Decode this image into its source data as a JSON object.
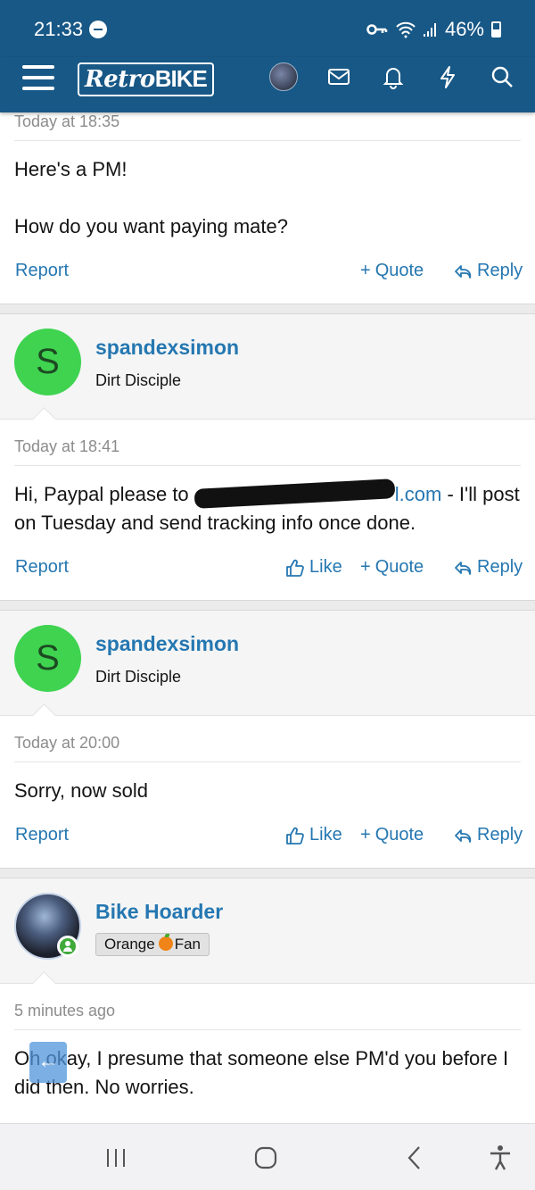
{
  "status": {
    "time": "21:33",
    "battery": "46%"
  },
  "nav": {
    "logo_prefix": "Retro",
    "logo_suffix": "BIKE"
  },
  "posts": [
    {
      "date": "Today at 18:35",
      "body": [
        "Here's a PM!",
        "How do you want paying mate?"
      ],
      "actions": {
        "report": "Report",
        "quote": "Quote",
        "reply": "Reply"
      }
    },
    {
      "user": {
        "initial": "S",
        "name": "spandexsimon",
        "title": "Dirt Disciple"
      },
      "date": "Today at 18:41",
      "body_pre": "Hi, Paypal please to ",
      "body_link": "l.com",
      "body_post": " - I'll post on Tuesday and send tracking info once done.",
      "actions": {
        "report": "Report",
        "like": "Like",
        "quote": "Quote",
        "reply": "Reply"
      }
    },
    {
      "user": {
        "initial": "S",
        "name": "spandexsimon",
        "title": "Dirt Disciple"
      },
      "date": "Today at 20:00",
      "body": "Sorry, now sold",
      "actions": {
        "report": "Report",
        "like": "Like",
        "quote": "Quote",
        "reply": "Reply"
      }
    },
    {
      "user": {
        "name": "Bike Hoarder",
        "banner_pre": "Orange",
        "banner_post": "Fan"
      },
      "date": "5 minutes ago",
      "body": "Oh okay, I presume that someone else PM'd you before I did then. No worries."
    }
  ],
  "icons": {
    "menu": "hamburger-icon",
    "messages": "envelope-icon",
    "alerts": "bell-icon",
    "whats_new": "bolt-icon",
    "search": "search-icon",
    "back": "arrow-left-icon"
  },
  "colors": {
    "header": "#185886",
    "link": "#2577b1",
    "avatar": "#3fd350"
  }
}
